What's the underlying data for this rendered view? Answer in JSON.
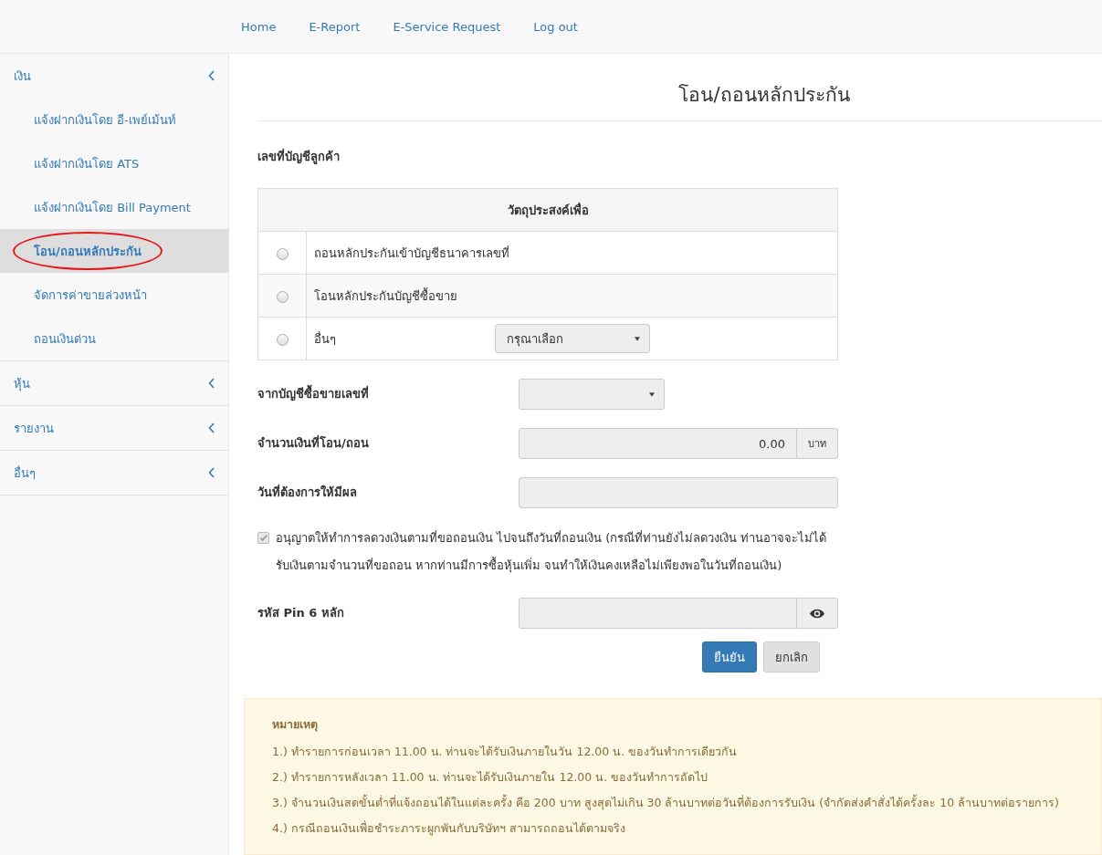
{
  "nav": [
    {
      "label": "Home"
    },
    {
      "label": "E-Report"
    },
    {
      "label": "E-Service Request"
    },
    {
      "label": "Log out"
    }
  ],
  "sidebar": [
    {
      "label": "เงิน",
      "children": [
        {
          "label": "แจ้งฝากเงินโดย อี-เพย์เม้นท์",
          "selected": false,
          "circled": false
        },
        {
          "label": "แจ้งฝากเงินโดย ATS",
          "selected": false,
          "circled": false
        },
        {
          "label": "แจ้งฝากเงินโดย Bill Payment",
          "selected": false,
          "circled": false
        },
        {
          "label": "โอน/ถอนหลักประกัน",
          "selected": true,
          "circled": true
        },
        {
          "label": "จัดการค่าขายล่วงหน้า",
          "selected": false,
          "circled": false
        },
        {
          "label": "ถอนเงินด่วน",
          "selected": false,
          "circled": false
        }
      ]
    },
    {
      "label": "หุ้น"
    },
    {
      "label": "รายงาน"
    },
    {
      "label": "อื่นๆ"
    }
  ],
  "page_title": "โอน/ถอนหลักประกัน",
  "customer_account_label": "เลขที่บัญชีลูกค้า",
  "purpose_table": {
    "heading": "วัตถุประสงค์เพื่อ",
    "options": [
      {
        "kind": "plain",
        "label": "ถอนหลักประกันเข้าบัญชีธนาคารเลขที่",
        "selected": false
      },
      {
        "kind": "plain",
        "label": "โอนหลักประกันบัญชีซื้อขาย",
        "selected": false
      },
      {
        "kind": "select",
        "label": "อื่นๆ",
        "selected": false,
        "placeholder": "กรุณาเลือก"
      }
    ]
  },
  "fields": [
    {
      "kind": "select",
      "label": "จากบัญชีซื้อขายเลขที่"
    },
    {
      "kind": "amount",
      "label": "จำนวนเงินที่โอน/ถอน",
      "value": "0.00",
      "unit": "บาท"
    },
    {
      "kind": "text",
      "label": "วันที่ต้องการให้มีผล"
    }
  ],
  "consent": {
    "checked": true,
    "disabled": true,
    "text": "อนุญาตให้ทำการลดวงเงินตามที่ขอถอนเงิน ไปจนถึงวันที่ถอนเงิน (กรณีที่ท่านยังไม่ลดวงเงิน ท่านอาจจะไม่ได้รับเงินตามจำนวนที่ขอถอน หากท่านมีการซื้อหุ้นเพิ่ม จนทำให้เงินคงเหลือไม่เพียงพอในวันที่ถอนเงิน)"
  },
  "pin_field": {
    "label": "รหัส Pin 6 หลัก"
  },
  "buttons": [
    {
      "kind": "primary",
      "label": "ยืนยัน"
    },
    {
      "kind": "default",
      "label": "ยกเลิก"
    }
  ],
  "note": {
    "title": "หมายเหตุ",
    "items": [
      "1.) ทำรายการก่อนเวลา 11.00 น. ท่านจะได้รับเงินภายในวัน 12.00 น. ของวันทำการเดียวกัน",
      "2.) ทำรายการหลังเวลา 11.00 น. ท่านจะได้รับเงินภายใน 12.00 น. ของวันทำการถัดไป",
      "3.) จำนวนเงินสดขั้นต่ำที่แจ้งถอนได้ในแต่ละครั้ง คือ 200 บาท สูงสุดไม่เกิน 30 ล้านบาทต่อวันที่ต้องการรับเงิน (จำกัดส่งคำสั่งได้ครั้งละ 10 ล้านบาทต่อรายการ)",
      "4.) กรณีถอนเงินเพื่อชำระภาระผูกพันกับบริษัทฯ สามารถถอนได้ตามจริง"
    ]
  }
}
